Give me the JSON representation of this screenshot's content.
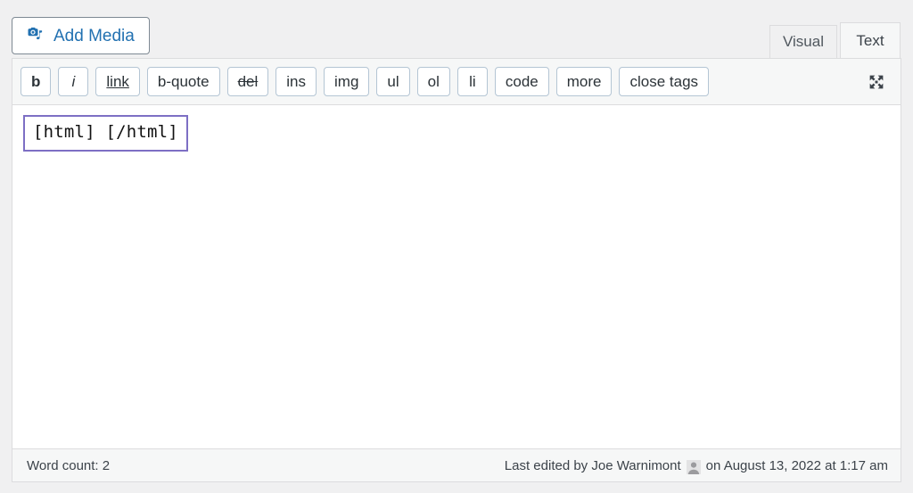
{
  "editor": {
    "add_media_label": "Add Media",
    "add_media_icon": "media-camera-music-icon",
    "tabs": [
      {
        "label": "Visual",
        "active": false
      },
      {
        "label": "Text",
        "active": true
      }
    ],
    "quicktags": [
      {
        "label": "b",
        "name": "quicktag-bold",
        "style": "bold"
      },
      {
        "label": "i",
        "name": "quicktag-italic",
        "style": "italic"
      },
      {
        "label": "link",
        "name": "quicktag-link",
        "style": "link"
      },
      {
        "label": "b-quote",
        "name": "quicktag-blockquote",
        "style": "plain"
      },
      {
        "label": "del",
        "name": "quicktag-del",
        "style": "del"
      },
      {
        "label": "ins",
        "name": "quicktag-ins",
        "style": "plain"
      },
      {
        "label": "img",
        "name": "quicktag-img",
        "style": "plain"
      },
      {
        "label": "ul",
        "name": "quicktag-ul",
        "style": "plain"
      },
      {
        "label": "ol",
        "name": "quicktag-ol",
        "style": "plain"
      },
      {
        "label": "li",
        "name": "quicktag-li",
        "style": "plain"
      },
      {
        "label": "code",
        "name": "quicktag-code",
        "style": "plain"
      },
      {
        "label": "more",
        "name": "quicktag-more",
        "style": "plain"
      },
      {
        "label": "close tags",
        "name": "quicktag-close-tags",
        "style": "plain"
      }
    ],
    "fullscreen_icon": "fullscreen-expand-arrows-icon",
    "content": {
      "text": "[html] [/html]",
      "selection_border_color": "#7d6fc4"
    },
    "footer": {
      "word_count_label": "Word count: 2",
      "last_edited_prefix": "Last edited by Joe Warnimont",
      "avatar_icon": "user-avatar",
      "last_edited_suffix": "on August 13, 2022 at 1:17 am"
    }
  },
  "colors": {
    "page_background": "#f0f0f1",
    "panel_background": "#ffffff",
    "toolbar_background": "#f6f7f7",
    "border": "#dcdcde",
    "button_border": "#b4c5d4",
    "link_blue": "#2271b1",
    "text_dark": "#3c434a",
    "selection_purple": "#7d6fc4"
  }
}
